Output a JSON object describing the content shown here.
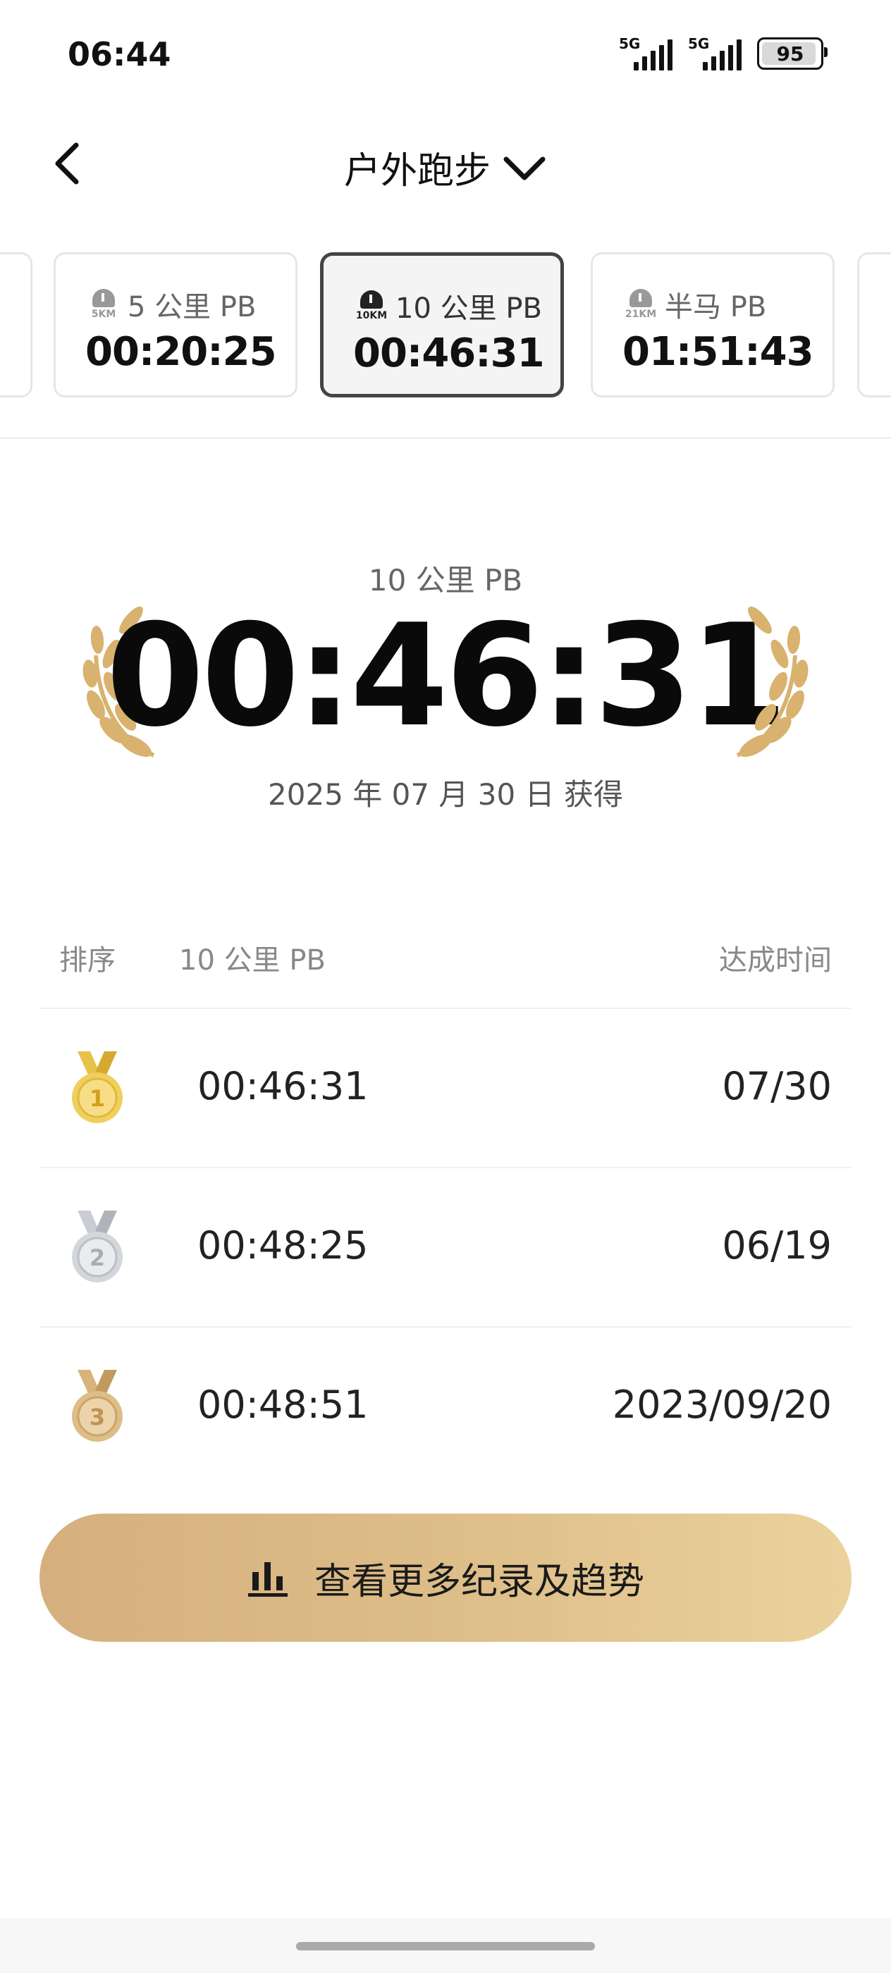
{
  "status_bar": {
    "time": "06:44",
    "signal1_label": "5G",
    "signal2_label": "5G",
    "battery": "95"
  },
  "header": {
    "title": "户外跑步"
  },
  "pb_cards": [
    {
      "id": "5k",
      "badge": "5KM",
      "label": "5 公里 PB",
      "value": "00:20:25",
      "active": false
    },
    {
      "id": "10k",
      "badge": "10KM",
      "label": "10 公里 PB",
      "value": "00:46:31",
      "active": true
    },
    {
      "id": "half",
      "badge": "21KM",
      "label": "半马 PB",
      "value": "01:51:43",
      "active": false
    }
  ],
  "hero": {
    "label": "10 公里 PB",
    "time": "00:46:31",
    "date": "2025 年 07 月 30 日 获得"
  },
  "table": {
    "headers": {
      "rank": "排序",
      "metric": "10 公里 PB",
      "date": "达成时间"
    },
    "rows": [
      {
        "rank": 1,
        "time": "00:46:31",
        "date": "07/30",
        "medal": "gold-medal-icon"
      },
      {
        "rank": 2,
        "time": "00:48:25",
        "date": "06/19",
        "medal": "silver-medal-icon"
      },
      {
        "rank": 3,
        "time": "00:48:51",
        "date": "2023/09/20",
        "medal": "bronze-medal-icon"
      }
    ]
  },
  "cta": {
    "label": "查看更多纪录及趋势",
    "icon": "bar-chart-icon"
  },
  "colors": {
    "gold_start": "#d5b07e",
    "gold_end": "#ebd29c",
    "laurel": "#d8b26e",
    "card_active_border": "#444444"
  }
}
